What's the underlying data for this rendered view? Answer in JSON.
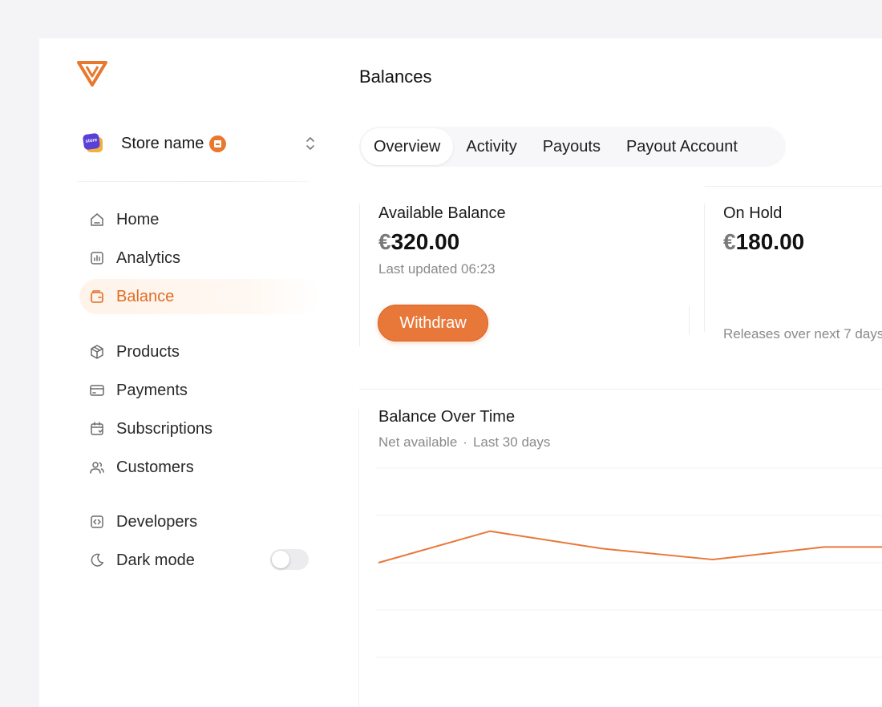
{
  "sidebar": {
    "store": {
      "name": "Store name",
      "avatar_text": "store"
    },
    "items": [
      {
        "key": "home",
        "label": "Home",
        "icon": "home-icon",
        "active": false
      },
      {
        "key": "analytics",
        "label": "Analytics",
        "icon": "bar-chart-icon",
        "active": false
      },
      {
        "key": "balance",
        "label": "Balance",
        "icon": "wallet-icon",
        "active": true
      },
      {
        "key": "products",
        "label": "Products",
        "icon": "box-icon",
        "active": false
      },
      {
        "key": "payments",
        "label": "Payments",
        "icon": "credit-card-icon",
        "active": false
      },
      {
        "key": "subscriptions",
        "label": "Subscriptions",
        "icon": "calendar-icon",
        "active": false
      },
      {
        "key": "customers",
        "label": "Customers",
        "icon": "users-icon",
        "active": false
      },
      {
        "key": "developers",
        "label": "Developers",
        "icon": "code-icon",
        "active": false
      },
      {
        "key": "dark_mode",
        "label": "Dark mode",
        "icon": "moon-icon",
        "active": false,
        "toggle_on": false
      }
    ]
  },
  "header": {
    "title": "Balances"
  },
  "tabs": [
    {
      "label": "Overview",
      "active": true
    },
    {
      "label": "Activity",
      "active": false
    },
    {
      "label": "Payouts",
      "active": false
    },
    {
      "label": "Payout Account",
      "active": false
    }
  ],
  "balances": {
    "available": {
      "label": "Available Balance",
      "currency": "€",
      "amount": "320.00",
      "updated": "Last updated 06:23",
      "button": "Withdraw"
    },
    "on_hold": {
      "label": "On Hold",
      "currency": "€",
      "amount": "180.00",
      "note": "Releases over next 7 days"
    }
  },
  "chart": {
    "title": "Balance Over Time",
    "subtitle_metric": "Net available",
    "subtitle_sep": "·",
    "subtitle_range": "Last 30 days"
  },
  "chart_data": {
    "type": "line",
    "x": [
      0,
      1,
      2,
      3,
      4,
      5
    ],
    "series": [
      {
        "values": [
          300,
          320,
          309,
          302,
          310,
          310
        ]
      }
    ],
    "ylim": [
      240,
      360
    ],
    "grid": true,
    "line_color": "#e8783a"
  },
  "colors": {
    "accent": "#e8783a",
    "active_nav_text": "#e06d24"
  }
}
